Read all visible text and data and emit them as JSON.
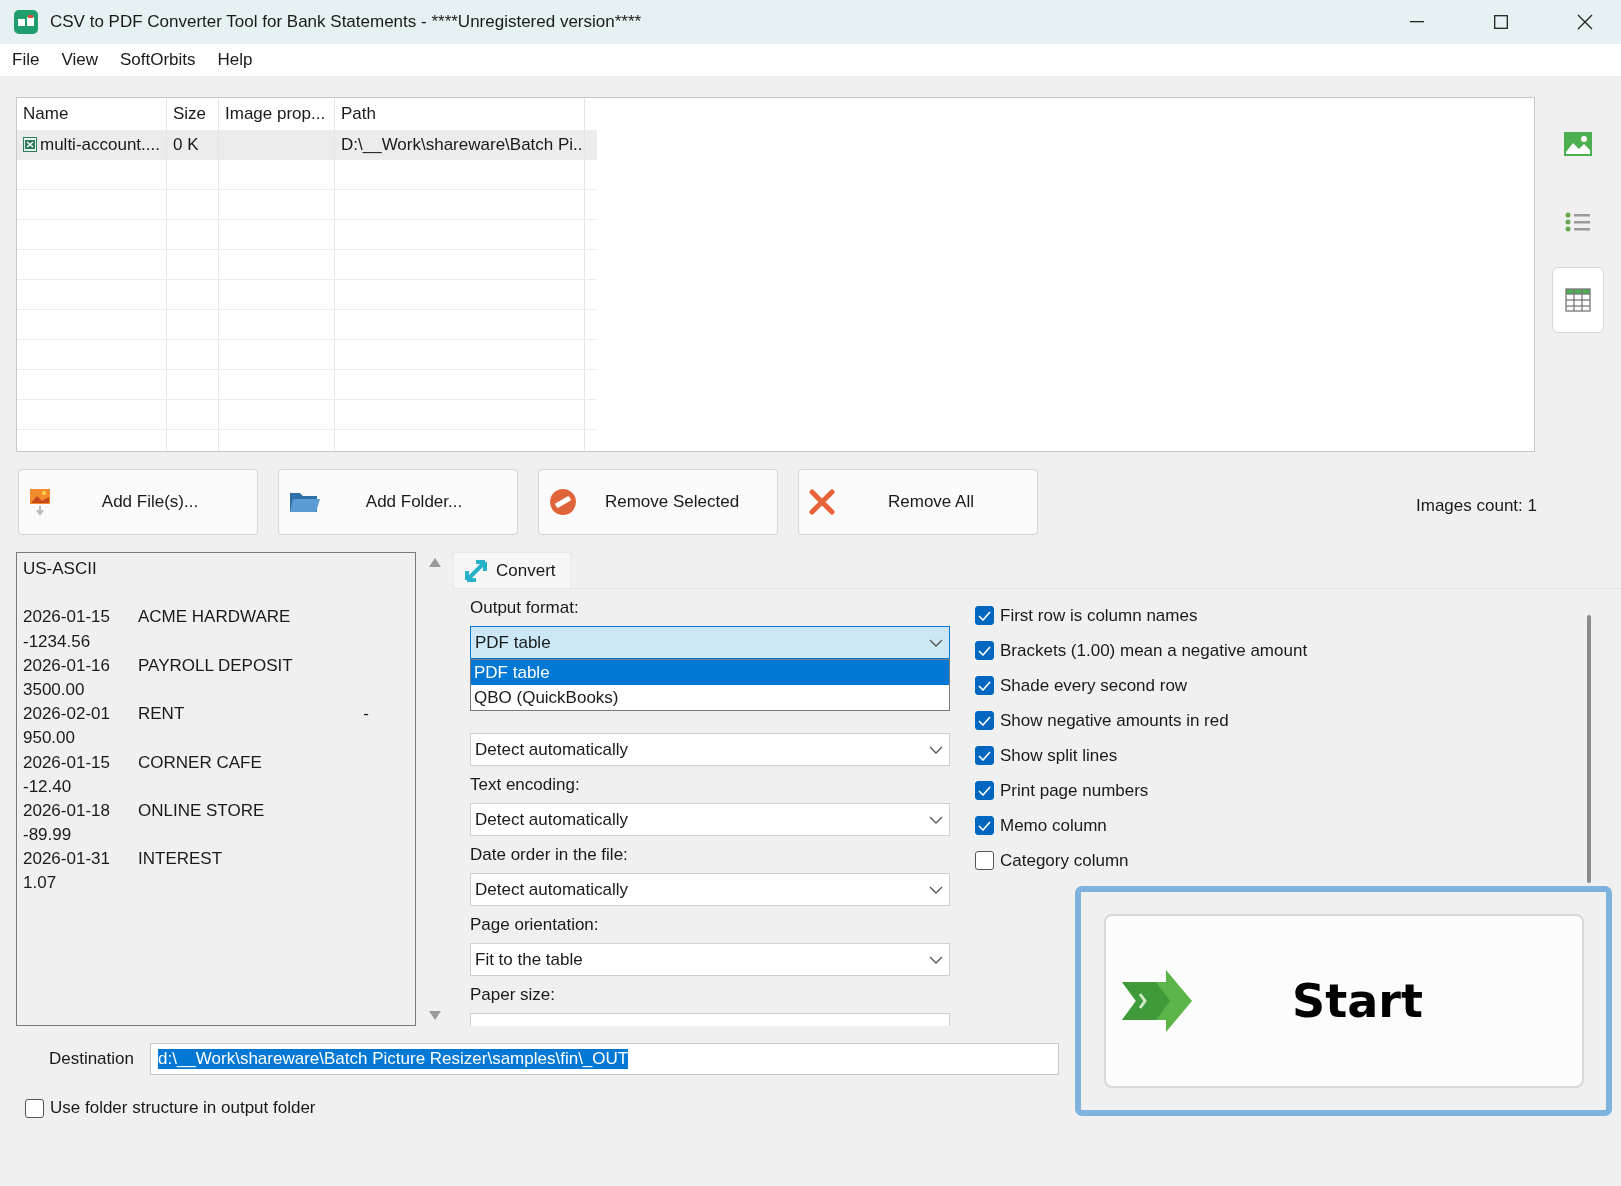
{
  "window": {
    "title": "CSV to PDF Converter Tool for Bank Statements - ****Unregistered version****"
  },
  "menu": [
    "File",
    "View",
    "SoftOrbits",
    "Help"
  ],
  "file_list": {
    "columns": [
      "Name",
      "Size",
      "Image prop...",
      "Path"
    ],
    "rows": [
      {
        "name": "multi-account....",
        "size": "0 K",
        "path": "D:\\__Work\\shareware\\Batch Pi...",
        "selected": true
      }
    ]
  },
  "view_buttons": [
    {
      "kind": "thumbnails",
      "selected": false
    },
    {
      "kind": "list",
      "selected": false
    },
    {
      "kind": "table",
      "selected": true
    }
  ],
  "buttons": [
    {
      "kind": "add-file",
      "label": "Add File(s)..."
    },
    {
      "kind": "add-folder",
      "label": "Add Folder..."
    },
    {
      "kind": "remove-selected",
      "label": "Remove Selected"
    },
    {
      "kind": "remove-all",
      "label": "Remove All"
    }
  ],
  "images_count": "Images count: 1",
  "preview": {
    "encoding": "US-ASCII",
    "records": [
      {
        "date": "2026-01-15",
        "description": "ACME HARDWARE",
        "amount": "-1234.56"
      },
      {
        "date": "2026-01-16",
        "description": "PAYROLL DEPOSIT",
        "amount": "3500.00"
      },
      {
        "date": "2026-02-01",
        "description": "RENT",
        "trail": "-",
        "amount": "950.00"
      },
      {
        "date": "2026-01-15",
        "description": "CORNER CAFE",
        "amount": "-12.40"
      },
      {
        "date": "2026-01-18",
        "description": "ONLINE STORE",
        "amount": "-89.99"
      },
      {
        "date": "2026-01-31",
        "description": "INTEREST",
        "amount": "1.07"
      }
    ]
  },
  "tab": {
    "label": "Convert",
    "selected": true
  },
  "fields": [
    {
      "label": "Output format:",
      "value": "PDF table",
      "expanded": true,
      "options": [
        {
          "label": "PDF table",
          "selected": true
        },
        {
          "label": "QBO (QuickBooks)",
          "selected": false
        }
      ]
    },
    {
      "value": "Detect automatically",
      "expanded": false
    },
    {
      "label": "Text encoding:",
      "value": "Detect automatically",
      "expanded": false
    },
    {
      "label": "Date order in the file:",
      "value": "Detect automatically",
      "expanded": false
    },
    {
      "label": "Page orientation:",
      "value": "Fit to the table",
      "expanded": false
    },
    {
      "label": "Paper size:",
      "expanded": false
    }
  ],
  "options": [
    {
      "label": "First row is column names",
      "checked": true
    },
    {
      "label": "Brackets (1.00) mean a negative amount",
      "checked": true
    },
    {
      "label": "Shade every second row",
      "checked": true
    },
    {
      "label": "Show negative amounts in red",
      "checked": true
    },
    {
      "label": "Show split lines",
      "checked": true
    },
    {
      "label": "Print page numbers",
      "checked": true
    },
    {
      "label": "Memo column",
      "checked": true
    },
    {
      "label": "Category column",
      "checked": false
    }
  ],
  "start_button": {
    "label": "Start"
  },
  "destination": {
    "label": "Destination",
    "value": "d:\\__Work\\shareware\\Batch Picture Resizer\\samples\\fin\\_OUT",
    "selected": true
  },
  "use_folder_structure": {
    "label": "Use folder structure in output folder",
    "checked": false
  }
}
